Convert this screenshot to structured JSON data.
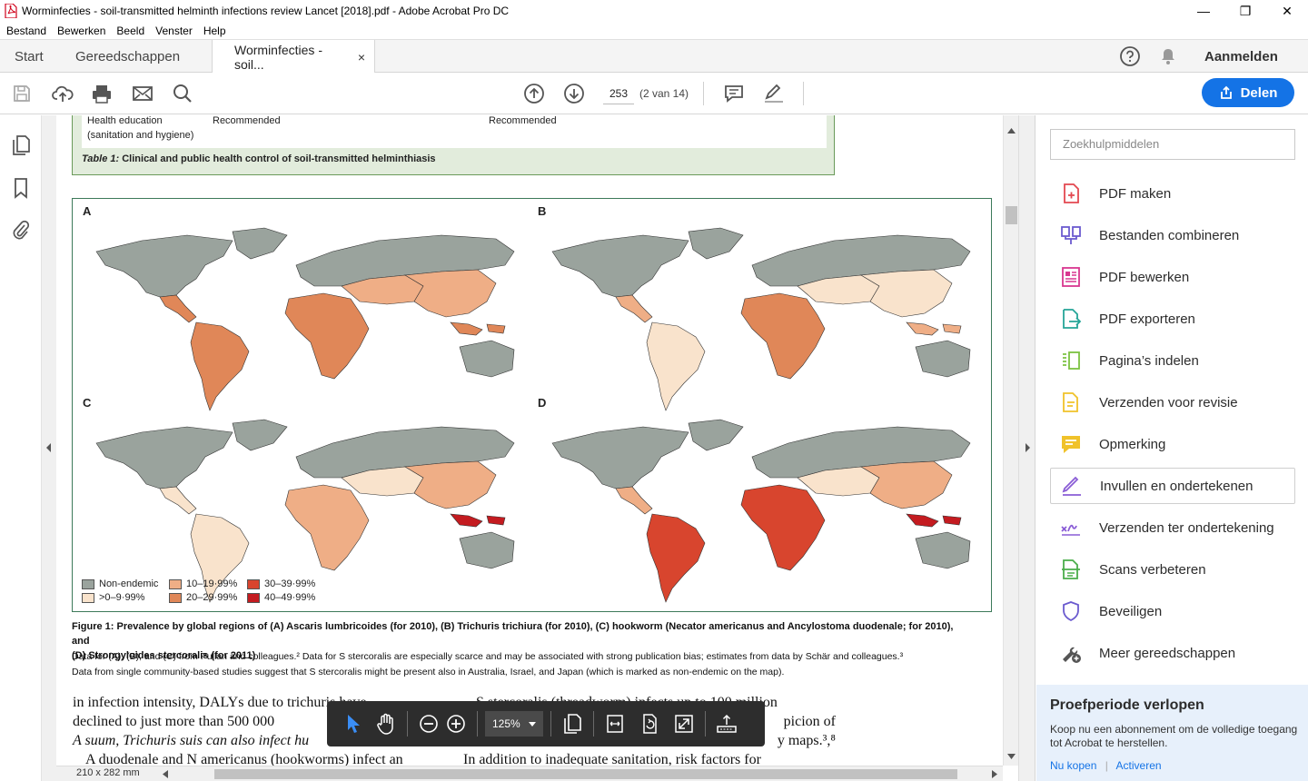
{
  "window": {
    "title": "Worminfecties - soil-transmitted helminth infections review Lancet [2018].pdf - Adobe Acrobat Pro DC",
    "minimize": "—",
    "maximize": "❐",
    "close": "✕"
  },
  "menu": [
    "Bestand",
    "Bewerken",
    "Beeld",
    "Venster",
    "Help"
  ],
  "tabs": {
    "home": "Start",
    "tools": "Gereedschappen",
    "doc": "Worminfecties - soil...",
    "doc_close": "×"
  },
  "header": {
    "signin": "Aanmelden"
  },
  "toolbar": {
    "page_number": "253",
    "page_of": "(2 van 14)",
    "share": "Delen"
  },
  "right_panel": {
    "search_placeholder": "Zoekhulpmiddelen",
    "tools": [
      {
        "label": "PDF maken",
        "icon": "create-pdf-icon",
        "color": "#e34850"
      },
      {
        "label": "Bestanden combineren",
        "icon": "combine-files-icon",
        "color": "#6b5bcf"
      },
      {
        "label": "PDF bewerken",
        "icon": "edit-pdf-icon",
        "color": "#d83790"
      },
      {
        "label": "PDF exporteren",
        "icon": "export-pdf-icon",
        "color": "#26a598"
      },
      {
        "label": "Pagina’s indelen",
        "icon": "organize-pages-icon",
        "color": "#7cc242"
      },
      {
        "label": "Verzenden voor revisie",
        "icon": "send-review-icon",
        "color": "#f0c22a"
      },
      {
        "label": "Opmerking",
        "icon": "comment-icon",
        "color": "#f0c22a"
      },
      {
        "label": "Invullen en ondertekenen",
        "icon": "fill-sign-icon",
        "color": "#8a5dd6"
      },
      {
        "label": "Verzenden ter ondertekening",
        "icon": "send-signature-icon",
        "color": "#8a5dd6"
      },
      {
        "label": "Scans verbeteren",
        "icon": "enhance-scans-icon",
        "color": "#4aad4a"
      },
      {
        "label": "Beveiligen",
        "icon": "protect-icon",
        "color": "#6b5bcf"
      },
      {
        "label": "Meer gereedschappen",
        "icon": "more-tools-icon",
        "color": "#555555"
      }
    ],
    "trial": {
      "heading": "Proefperiode verlopen",
      "text": "Koop nu een abonnement om de volledige toegang tot Acrobat te herstellen.",
      "buy": "Nu kopen",
      "activate": "Activeren"
    }
  },
  "document": {
    "table_row": {
      "col1_line1": "Health education",
      "col1_line2": "(sanitation and hygiene)",
      "col2": "Recommended",
      "col3": "Recommended"
    },
    "table_caption_bold": "Table 1:",
    "table_caption": "Clinical and public health control of soil-transmitted helminthiasis",
    "map_labels": [
      "A",
      "B",
      "C",
      "D"
    ],
    "legend": [
      {
        "label": "Non-endemic",
        "color": "#9aa39d"
      },
      {
        "label": ">0–9·99%",
        "color": "#f9e3cc"
      },
      {
        "label": "10–19·99%",
        "color": "#efae86"
      },
      {
        "label": "20–29·99%",
        "color": "#e08758"
      },
      {
        "label": "30–39·99%",
        "color": "#d8452e"
      },
      {
        "label": "40–49·99%",
        "color": "#c41b20"
      }
    ],
    "figure_caption_line1": "Figure 1: Prevalence by global regions of (A) Ascaris lumbricoides (for 2010), (B) Trichuris trichiura (for 2010), (C) hookworm (Necator americanus and Ancylostoma duodenale; for 2010), and",
    "figure_caption_line2": "(D) Strongyloides stercoralis (for 2011)",
    "figure_note_line1": "Data for (A), (B), and (C) from Pullan and colleagues.² Data for S stercoralis are especially scarce and may be associated with strong publication bias; estimates from data by Schär and colleagues.³",
    "figure_note_line2": "Data from single community-based studies suggest that S stercoralis might be present also in Australia, Israel, and Japan (which is marked as non-endemic on the map).",
    "body_left": [
      "in infection intensity, DALYs due to trichuris have",
      "declined to just more than 500 000",
      "A suum, Trichuris suis can also infect hu",
      "A duodenale and N americanus (hookworms) infect an"
    ],
    "body_right": [
      "S stercoralis (threadworm) infects up to 100 million",
      "picion of",
      "y maps.³,⁸",
      "In addition to inadequate sanitation, risk factors for"
    ],
    "page_size": "210 x 282 mm"
  },
  "floating_toolbar": {
    "zoom": "125%"
  }
}
